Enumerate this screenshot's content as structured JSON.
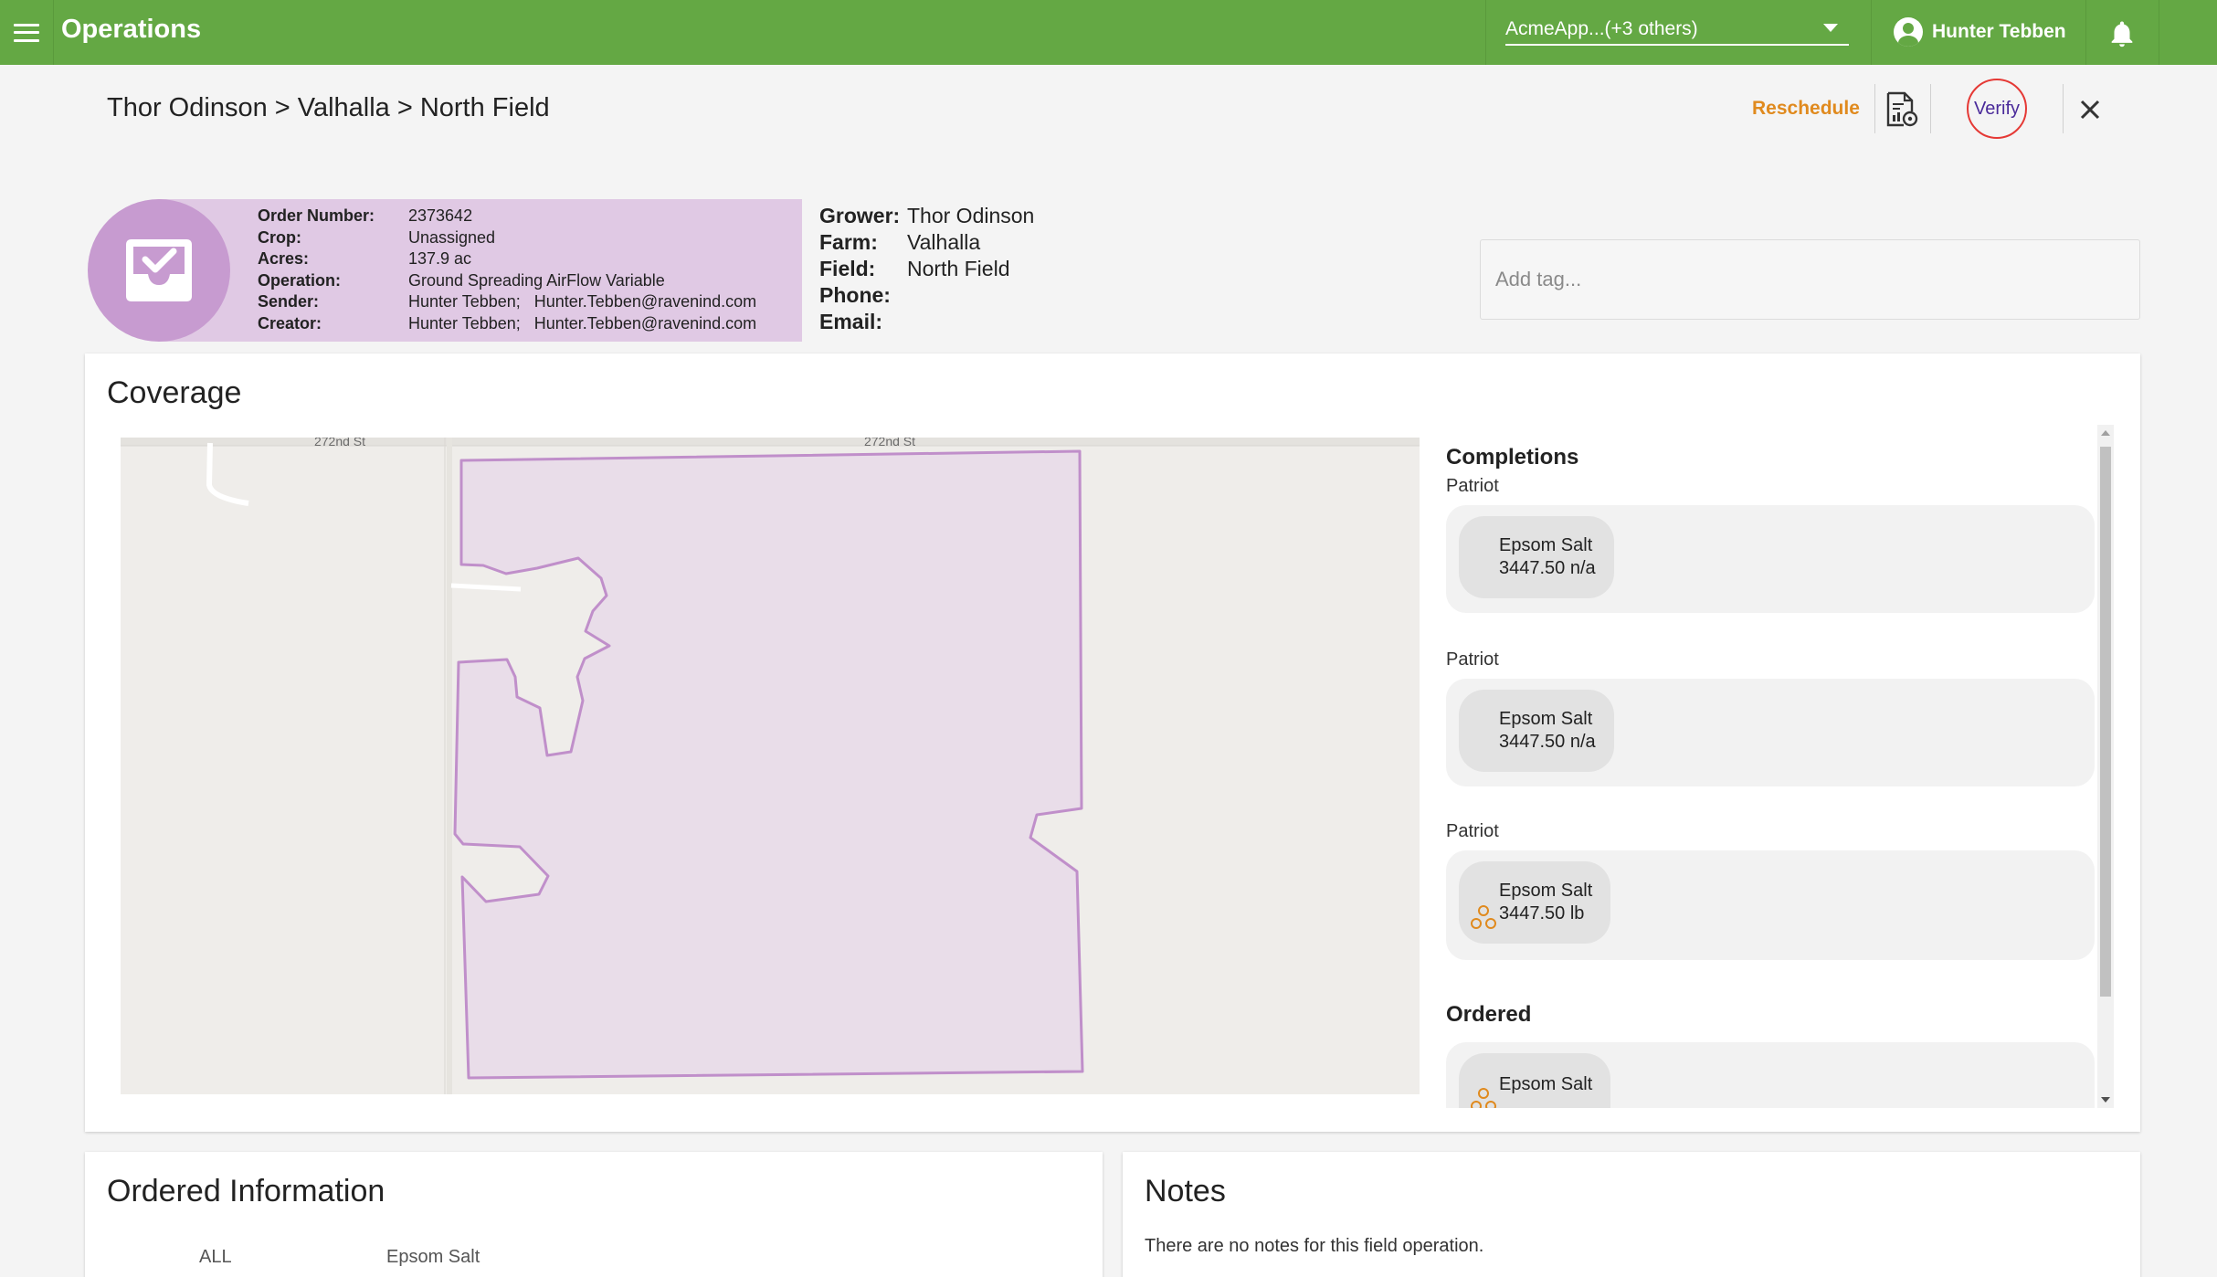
{
  "topbar": {
    "title": "Operations",
    "org_selector": "AcmeApp...(+3 others)",
    "user_name": "Hunter Tebben"
  },
  "header": {
    "breadcrumb": "Thor Odinson > Valhalla > North Field",
    "reschedule": "Reschedule",
    "verify": "Verify"
  },
  "order": {
    "rows": [
      {
        "label": "Order Number:",
        "value": "2373642"
      },
      {
        "label": "Crop:",
        "value": "Unassigned"
      },
      {
        "label": "Acres:",
        "value": "137.9 ac"
      },
      {
        "label": "Operation:",
        "value": "Ground Spreading AirFlow Variable"
      },
      {
        "label": "Sender:",
        "value": "Hunter Tebben;   Hunter.Tebben@ravenind.com"
      },
      {
        "label": "Creator:",
        "value": "Hunter Tebben;   Hunter.Tebben@ravenind.com"
      }
    ]
  },
  "grower": {
    "rows": [
      {
        "label": "Grower:",
        "value": "Thor Odinson"
      },
      {
        "label": "Farm:",
        "value": "Valhalla"
      },
      {
        "label": "Field:",
        "value": "North Field"
      },
      {
        "label": "Phone:",
        "value": ""
      },
      {
        "label": "Email:",
        "value": ""
      }
    ]
  },
  "tags": {
    "placeholder": "Add tag..."
  },
  "coverage": {
    "title": "Coverage",
    "map": {
      "street_label_left": "272nd St",
      "street_label_right": "272nd St"
    },
    "completions_heading": "Completions",
    "completions": [
      {
        "source": "Patriot",
        "product": "Epsom Salt",
        "amount": "3447.50 n/a"
      },
      {
        "source": "Patriot",
        "product": "Epsom Salt",
        "amount": "3447.50 n/a"
      },
      {
        "source": "Patriot",
        "product": "Epsom Salt",
        "amount": "3447.50 lb"
      }
    ],
    "ordered_heading": "Ordered",
    "ordered": [
      {
        "product": "Epsom Salt"
      }
    ]
  },
  "ordered_info": {
    "title": "Ordered Information",
    "columns": [
      "ALL",
      "Epsom Salt"
    ]
  },
  "notes": {
    "title": "Notes",
    "empty_text": "There are no notes for this field operation."
  },
  "colors": {
    "topbar": "#64a844",
    "reschedule": "#e08a1e",
    "verify_ring": "#e53935",
    "order_card": "#e0c9e4",
    "order_icon_bg": "#c79bd0",
    "field_outline": "#c08fca",
    "field_fill": "#e9dde9"
  },
  "icons": [
    "menu-icon",
    "account-circle-icon",
    "bell-icon",
    "report-settings-icon",
    "close-icon",
    "inbox-check-icon",
    "rate-points-icon"
  ]
}
